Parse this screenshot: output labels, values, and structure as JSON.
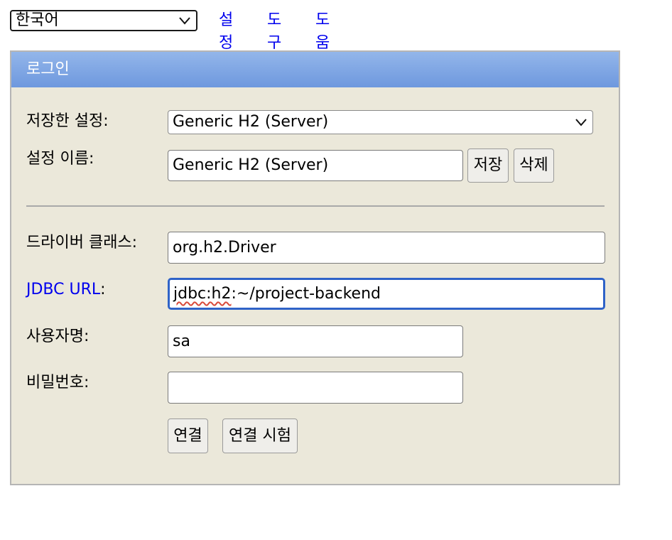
{
  "topbar": {
    "language_select": {
      "value": "한국어"
    },
    "links": {
      "settings": "설정",
      "tools": "도구",
      "help": "도움말"
    }
  },
  "panel": {
    "title": "로그인",
    "saved_settings": {
      "label": "저장한 설정:",
      "value": "Generic H2 (Server)"
    },
    "setting_name": {
      "label": "설정 이름:",
      "value": "Generic H2 (Server)"
    },
    "save_button": "저장",
    "delete_button": "삭제",
    "driver_class": {
      "label": "드라이버 클래스:",
      "value": "org.h2.Driver"
    },
    "jdbc_url": {
      "label_link": "JDBC URL",
      "label_suffix": ":",
      "value_prefix": "jdbc:h2",
      "value_rest": ":~/project-backend"
    },
    "username": {
      "label": "사용자명:",
      "value": "sa"
    },
    "password": {
      "label": "비밀번호:",
      "value": ""
    },
    "connect_button": "연결",
    "test_button": "연결 시험"
  },
  "colors": {
    "panel_bg": "#ebe8da",
    "header_gradient_top": "#93b6ea",
    "header_gradient_bottom": "#6e98de",
    "link": "#0000ee",
    "focus_border": "#2f63c8"
  },
  "icons": {
    "select_arrow": "chevron-down-icon"
  }
}
